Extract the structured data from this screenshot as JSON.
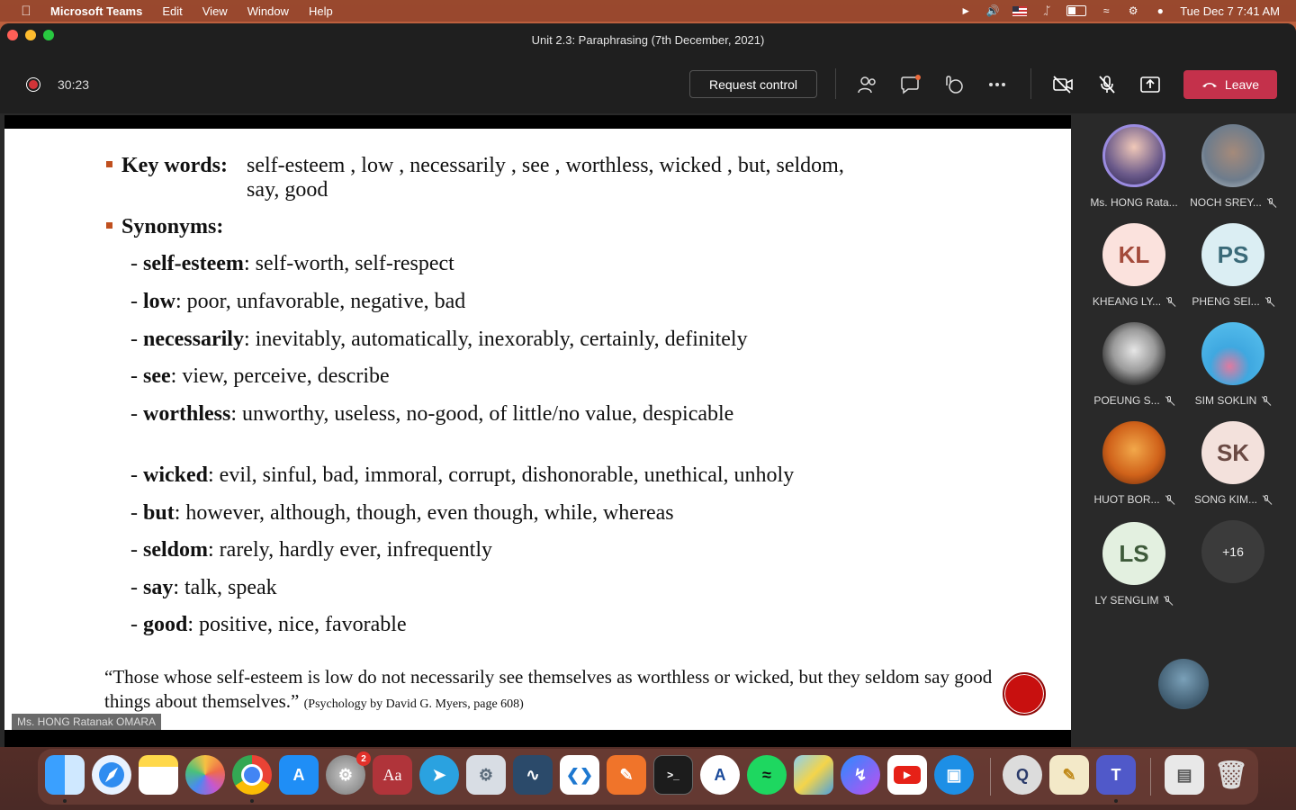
{
  "menubar": {
    "app_name": "Microsoft Teams",
    "items": [
      "Edit",
      "View",
      "Window",
      "Help"
    ],
    "clock": "Tue Dec 7  7:41 AM"
  },
  "window": {
    "title": "Unit 2.3: Paraphrasing (7th December, 2021)"
  },
  "toolbar": {
    "timer": "30:23",
    "request_control": "Request control",
    "leave": "Leave",
    "icons": [
      "people-icon",
      "chat-icon",
      "reactions-icon",
      "more-icon",
      "camera-off-icon",
      "mic-off-icon",
      "share-icon"
    ]
  },
  "slide": {
    "keywords_label": "Key words:",
    "keywords_text_1": "self-esteem , low , necessarily , see , worthless,  wicked , but, seldom,",
    "keywords_text_2": "say, good",
    "synonyms_label": "Synonyms:",
    "synonyms": [
      {
        "term": "self-esteem",
        "def": ": self-worth, self-respect"
      },
      {
        "term": "low",
        "def": ": poor, unfavorable, negative, bad"
      },
      {
        "term": "necessarily",
        "def": ": inevitably, automatically, inexorably, certainly, definitely"
      },
      {
        "term": "see",
        "def": ": view, perceive, describe"
      },
      {
        "term": "worthless",
        "def": ": unworthy, useless, no-good, of little/no value, despicable"
      },
      {
        "term": "wicked",
        "def": ": evil, sinful, bad, immoral, corrupt, dishonorable, unethical, unholy"
      },
      {
        "term": "but",
        "def": ": however, although, though, even though, while, whereas"
      },
      {
        "term": "seldom",
        "def": ": rarely, hardly ever, infrequently"
      },
      {
        "term": "say",
        "def": ": talk, speak"
      },
      {
        "term": "good",
        "def": ": positive, nice, favorable"
      }
    ],
    "quote": "“Those whose self-esteem is low do not necessarily see themselves as worthless or wicked, but they seldom say good things about themselves.”",
    "citation": "(Psychology by David G. Myers, page 608)",
    "presenter_tag": "Ms. HONG Ratanak OMARA"
  },
  "participants": [
    {
      "name": "Ms. HONG Rata...",
      "initials": "",
      "muted": false
    },
    {
      "name": "NOCH SREY...",
      "initials": "",
      "muted": true
    },
    {
      "name": "KHEANG LY...",
      "initials": "KL",
      "muted": true
    },
    {
      "name": "PHENG SEI...",
      "initials": "PS",
      "muted": true
    },
    {
      "name": "POEUNG S...",
      "initials": "",
      "muted": true
    },
    {
      "name": "SIM SOKLIN",
      "initials": "",
      "muted": true
    },
    {
      "name": "HUOT BOR...",
      "initials": "",
      "muted": true
    },
    {
      "name": "SONG KIM...",
      "initials": "SK",
      "muted": true
    },
    {
      "name": "LY SENGLIM",
      "initials": "LS",
      "muted": true
    },
    {
      "name": "",
      "initials": "+16",
      "muted": false
    }
  ],
  "dock": {
    "apps": [
      "finder-icon",
      "safari-icon",
      "notes-icon",
      "photos-icon",
      "chrome-icon",
      "app-store-icon",
      "system-preferences-icon",
      "dictionary-icon",
      "telegram-icon",
      "settings-icon",
      "mysql-workbench-icon",
      "vscode-icon",
      "draw-icon",
      "terminal-icon",
      "xcode-instruments-icon",
      "spotify-icon",
      "virtualbox-icon",
      "messenger-icon",
      "youtube-icon",
      "docker-icon",
      "quicktime-icon",
      "pages-icon",
      "teams-icon",
      "documents-icon",
      "trash-icon"
    ],
    "settings_badge": "2",
    "dictionary_label": "Aa"
  }
}
